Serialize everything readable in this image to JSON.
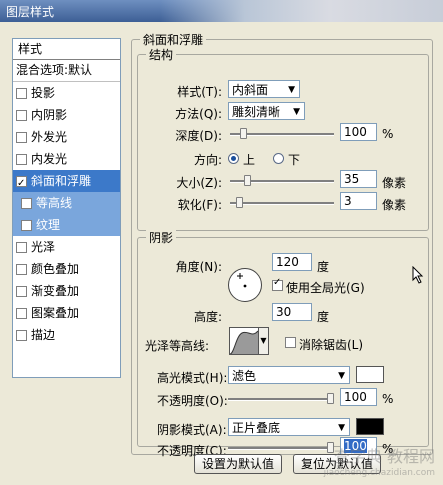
{
  "window": {
    "title": "图层样式"
  },
  "left_panel": {
    "header": "样式",
    "blend": "混合选项:默认",
    "items": [
      {
        "label": "投影",
        "checked": false
      },
      {
        "label": "内阴影",
        "checked": false
      },
      {
        "label": "外发光",
        "checked": false
      },
      {
        "label": "内发光",
        "checked": false
      },
      {
        "label": "斜面和浮雕",
        "checked": true,
        "selected": true
      },
      {
        "label": "等高线",
        "checked": false,
        "sub": true
      },
      {
        "label": "纹理",
        "checked": false,
        "sub": true
      },
      {
        "label": "光泽",
        "checked": false
      },
      {
        "label": "颜色叠加",
        "checked": false
      },
      {
        "label": "渐变叠加",
        "checked": false
      },
      {
        "label": "图案叠加",
        "checked": false
      },
      {
        "label": "描边",
        "checked": false
      }
    ]
  },
  "bevel": {
    "group_title": "斜面和浮雕",
    "structure_title": "结构",
    "style_label": "样式(T):",
    "style_value": "内斜面",
    "method_label": "方法(Q):",
    "method_value": "雕刻清晰",
    "depth_label": "深度(D):",
    "depth_value": "100",
    "depth_unit": "%",
    "depth_level": 0.1,
    "direction_label": "方向:",
    "direction_up": "上",
    "direction_down": "下",
    "direction_selected": "up",
    "size_label": "大小(Z):",
    "size_value": "35",
    "size_unit": "像素",
    "size_level": 0.14,
    "soften_label": "软化(F):",
    "soften_value": "3",
    "soften_unit": "像素",
    "soften_level": 0.06
  },
  "shading": {
    "title": "阴影",
    "angle_label": "角度(N):",
    "angle_value": "120",
    "angle_unit": "度",
    "global_light_label": "使用全局光(G)",
    "global_light_checked": true,
    "altitude_label": "高度:",
    "altitude_value": "30",
    "altitude_unit": "度",
    "gloss_contour_label": "光泽等高线:",
    "anti_alias_label": "消除锯齿(L)",
    "anti_alias_checked": false,
    "highlight_mode_label": "高光模式(H):",
    "highlight_mode_value": "滤色",
    "highlight_color": "#ffffff",
    "highlight_opacity_label": "不透明度(O):",
    "highlight_opacity_value": "100",
    "highlight_opacity_unit": "%",
    "highlight_opacity_level": 1.0,
    "shadow_mode_label": "阴影模式(A):",
    "shadow_mode_value": "正片叠底",
    "shadow_color": "#000000",
    "shadow_opacity_label": "不透明度(C):",
    "shadow_opacity_value": "100",
    "shadow_opacity_unit": "%",
    "shadow_opacity_level": 1.0
  },
  "buttons": {
    "make_default": "设置为默认值",
    "reset_default": "复位为默认值"
  },
  "watermark": {
    "line1": "查字典 教程网",
    "line2": "jiaocheng.chazidian.com"
  }
}
